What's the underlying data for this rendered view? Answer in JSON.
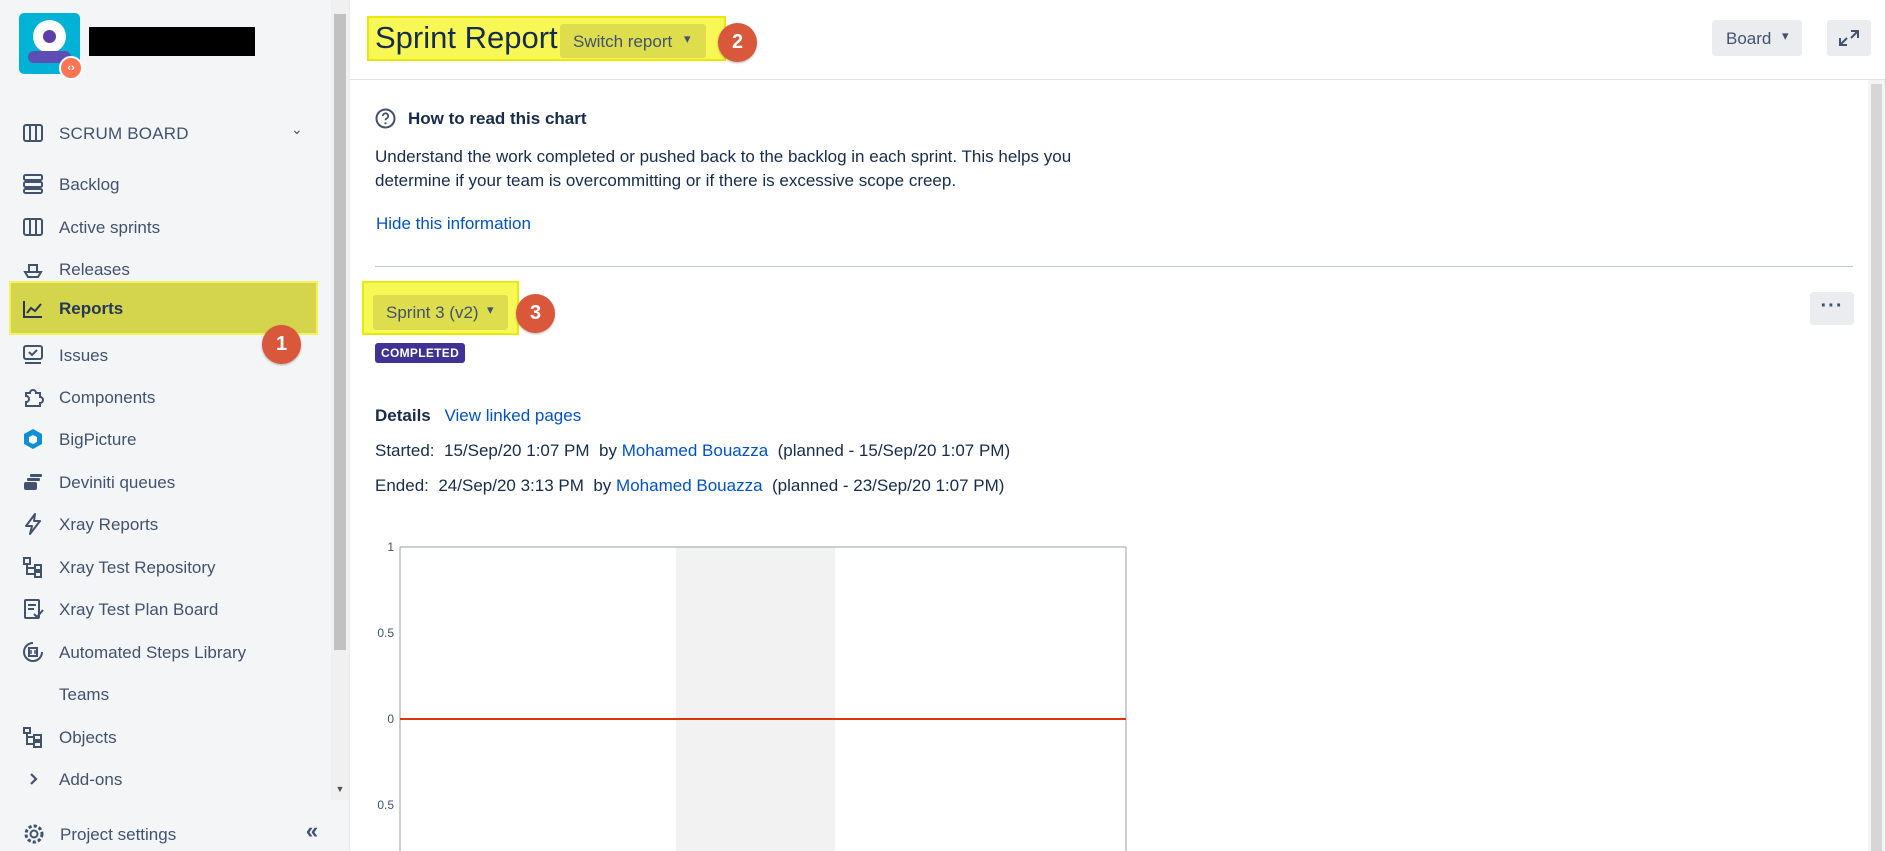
{
  "sidebar": {
    "project_name_redacted": true,
    "board_switcher": {
      "label": "SCRUM BOARD"
    },
    "items": [
      {
        "label": "Backlog",
        "icon": "backlog-icon"
      },
      {
        "label": "Active sprints",
        "icon": "board-columns-icon"
      },
      {
        "label": "Releases",
        "icon": "ship-icon"
      },
      {
        "label": "Reports",
        "icon": "chart-line-icon",
        "active": true
      },
      {
        "label": "Issues",
        "icon": "issues-icon"
      },
      {
        "label": "Components",
        "icon": "puzzle-icon"
      },
      {
        "label": "BigPicture",
        "icon": "bigpicture-icon"
      },
      {
        "label": "Deviniti queues",
        "icon": "queues-icon"
      },
      {
        "label": "Xray Reports",
        "icon": "lightning-icon"
      },
      {
        "label": "Xray Test Repository",
        "icon": "repository-icon"
      },
      {
        "label": "Xray Test Plan Board",
        "icon": "test-plan-icon"
      },
      {
        "label": "Automated Steps Library",
        "icon": "steps-library-icon"
      },
      {
        "label": "Teams",
        "icon": ""
      },
      {
        "label": "Objects",
        "icon": "objects-icon"
      },
      {
        "label": "Add-ons",
        "icon": "chevron-right-icon"
      }
    ],
    "project_settings": {
      "label": "Project settings"
    }
  },
  "annotations": {
    "badge1": "1",
    "badge2": "2",
    "badge3": "3"
  },
  "header": {
    "title": "Sprint Report",
    "switch_report_label": "Switch report",
    "board_label": "Board"
  },
  "help": {
    "heading": "How to read this chart",
    "text": "Understand the work completed or pushed back to the backlog in each sprint. This helps you determine if your team is overcommitting or if there is excessive scope creep.",
    "hide_link": "Hide this information"
  },
  "sprint": {
    "select_label": "Sprint 3 (v2)",
    "status": "COMPLETED",
    "details_label": "Details",
    "view_linked_pages": "View linked pages",
    "started_label": "Started:",
    "started_date": "15/Sep/20 1:07 PM",
    "started_by_label": "by",
    "started_by": "Mohamed Bouazza",
    "started_planned": "(planned - 15/Sep/20 1:07 PM)",
    "ended_label": "Ended:",
    "ended_date": "24/Sep/20 3:13 PM",
    "ended_by_label": "by",
    "ended_by": "Mohamed Bouazza",
    "ended_planned": "(planned - 23/Sep/20 1:07 PM)"
  },
  "colors": {
    "highlight": "#f7f756",
    "badge": "#d9573b",
    "link": "#0052cc",
    "lozenge": "#403294",
    "guideline": "#de350b"
  },
  "chart_data": {
    "type": "line",
    "y_ticks": [
      "1",
      "0.5",
      "0",
      "0.5"
    ],
    "ylim": [
      -0.5,
      1
    ],
    "series": [
      {
        "values": [
          0,
          0
        ]
      }
    ],
    "shaded_band": true,
    "grid": false
  }
}
